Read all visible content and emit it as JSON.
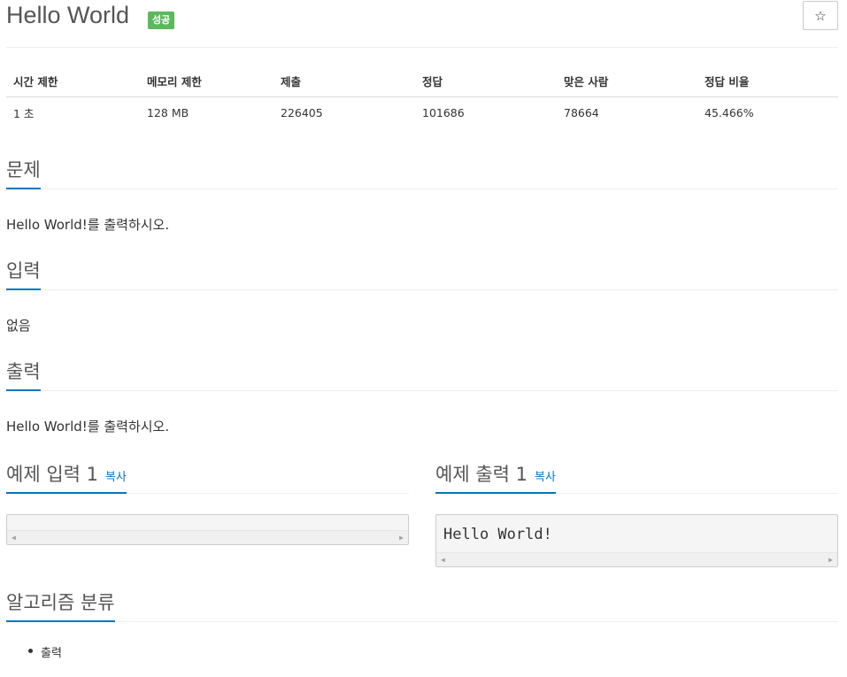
{
  "problem": {
    "title": "Hello World",
    "badge": "성공",
    "star_icon": "star-outline-icon"
  },
  "info_table": {
    "headers": [
      "시간 제한",
      "메모리 제한",
      "제출",
      "정답",
      "맞은 사람",
      "정답 비율"
    ],
    "values": [
      "1 초",
      "128 MB",
      "226405",
      "101686",
      "78664",
      "45.466%"
    ]
  },
  "sections": {
    "description": {
      "heading": "문제",
      "text": "Hello World!를 출력하시오."
    },
    "input": {
      "heading": "입력",
      "text": "없음"
    },
    "output": {
      "heading": "출력",
      "text": "Hello World!를 출력하시오."
    }
  },
  "samples": {
    "input": {
      "heading": "예제 입력 1",
      "copy_label": "복사",
      "content": ""
    },
    "output": {
      "heading": "예제 출력 1",
      "copy_label": "복사",
      "content": "Hello World!"
    }
  },
  "algorithm": {
    "heading": "알고리즘 분류",
    "tags": [
      "출력"
    ]
  },
  "colors": {
    "accent": "#0076c0",
    "success_badge": "#5cb85c"
  }
}
